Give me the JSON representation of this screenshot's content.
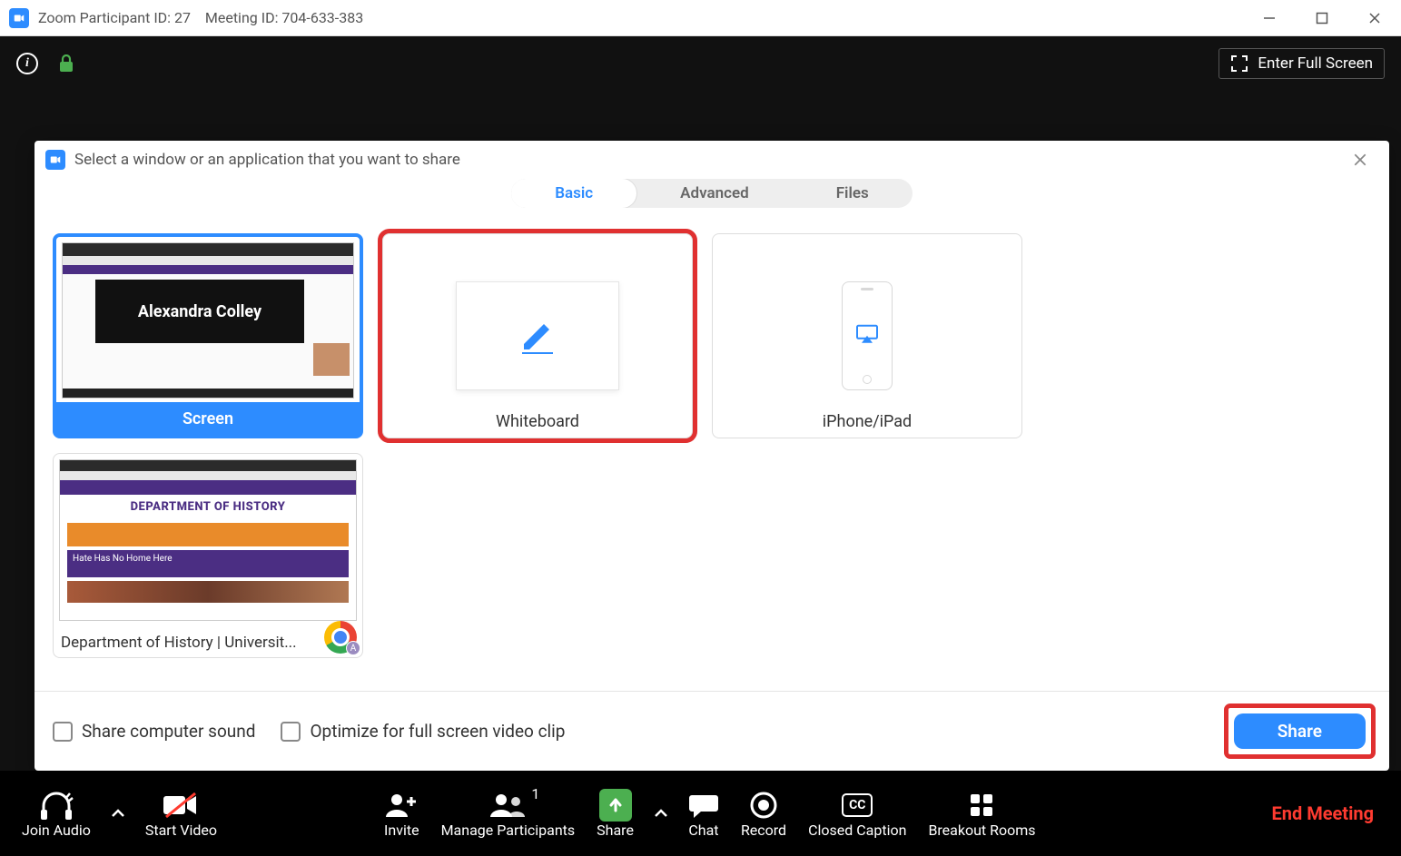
{
  "titlebar": {
    "participant_label": "Zoom Participant ID: 27",
    "meeting_label": "Meeting ID: 704-633-383"
  },
  "stage": {
    "fullscreen_label": "Enter Full Screen"
  },
  "dialog": {
    "title": "Select a window or an application that you want to share",
    "tabs": {
      "basic": "Basic",
      "advanced": "Advanced",
      "files": "Files"
    },
    "options": {
      "screen": {
        "label": "Screen",
        "overlay_name": "Alexandra Colley"
      },
      "whiteboard": {
        "label": "Whiteboard"
      },
      "iphone": {
        "label": "iPhone/iPad"
      },
      "window1": {
        "label": "Department of History | Universit...",
        "page_title": "DEPARTMENT OF HISTORY",
        "hero_text": "Hate Has No Home Here",
        "badge_letter": "A"
      }
    },
    "footer": {
      "share_sound": "Share computer sound",
      "optimize_clip": "Optimize for full screen video clip",
      "share_btn": "Share"
    }
  },
  "toolbar": {
    "join_audio": "Join Audio",
    "start_video": "Start Video",
    "invite": "Invite",
    "manage_participants": "Manage Participants",
    "participants_count": "1",
    "share": "Share",
    "chat": "Chat",
    "record": "Record",
    "closed_caption": "Closed Caption",
    "cc_badge": "CC",
    "breakout": "Breakout Rooms",
    "end_meeting": "End Meeting"
  }
}
